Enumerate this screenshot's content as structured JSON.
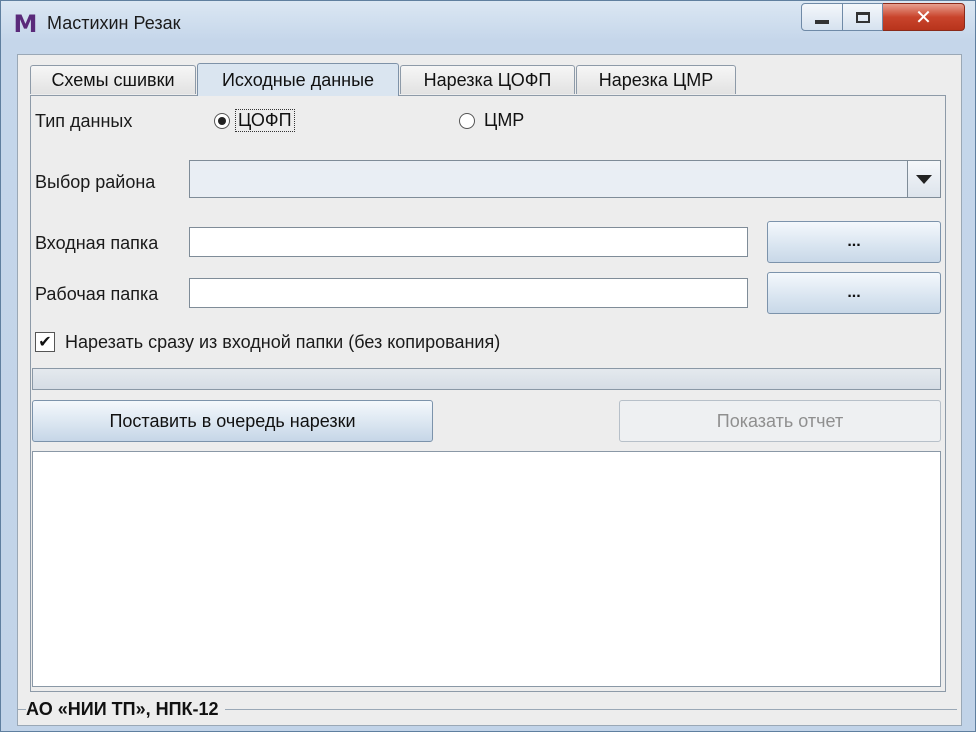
{
  "window": {
    "title": "Мастихин Резак",
    "logo_letter": "M",
    "close_glyph": "✕"
  },
  "tabs": [
    {
      "label": "Схемы сшивки",
      "active": false
    },
    {
      "label": "Исходные данные",
      "active": true
    },
    {
      "label": "Нарезка ЦОФП",
      "active": false
    },
    {
      "label": "Нарезка ЦМР",
      "active": false
    }
  ],
  "form": {
    "data_type_label": "Тип данных",
    "radio_options": [
      {
        "label": "ЦОФП",
        "selected": true
      },
      {
        "label": "ЦМР",
        "selected": false
      }
    ],
    "region_label": "Выбор района",
    "region_value": "",
    "input_folder_label": "Входная папка",
    "input_folder_value": "",
    "work_folder_label": "Рабочая папка",
    "work_folder_value": "",
    "browse_label": "...",
    "checkbox_label": "Нарезать сразу из входной папки (без копирования)",
    "checkbox_checked": true,
    "checkbox_glyph": "✔",
    "progress": 0
  },
  "actions": {
    "queue_label": "Поставить в очередь нарезки",
    "report_label": "Показать отчет",
    "report_enabled": false
  },
  "log": {
    "text": ""
  },
  "status": {
    "text": "АО «НИИ ТП», НПК-12"
  }
}
